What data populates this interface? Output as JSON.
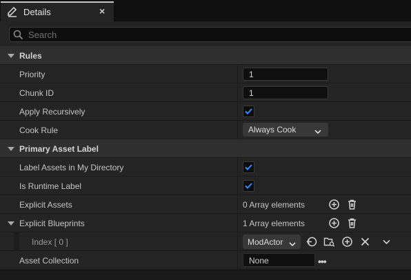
{
  "tab": {
    "title": "Details",
    "close": "×"
  },
  "search": {
    "placeholder": "Search",
    "value": ""
  },
  "rules": {
    "label": "Rules",
    "priority": {
      "label": "Priority",
      "value": "1"
    },
    "chunk_id": {
      "label": "Chunk ID",
      "value": "1"
    },
    "apply_recursively": {
      "label": "Apply Recursively",
      "checked": true
    },
    "cook_rule": {
      "label": "Cook Rule",
      "value": "Always Cook"
    }
  },
  "primary_asset_label": {
    "label": "Primary Asset Label",
    "label_assets": {
      "label": "Label Assets in My Directory",
      "checked": true
    },
    "is_runtime": {
      "label": "Is Runtime Label",
      "checked": true
    },
    "explicit_assets": {
      "label": "Explicit Assets",
      "value": "0 Array elements"
    },
    "explicit_blueprints": {
      "label": "Explicit Blueprints",
      "value": "1 Array elements"
    },
    "index0": {
      "label": "Index [ 0 ]",
      "value": "ModActor"
    },
    "asset_collection": {
      "label": "Asset Collection",
      "value": "None",
      "more": "•••"
    }
  },
  "colors": {
    "accent": "#2f8fff",
    "panel": "#242424",
    "category": "#2f2f2f"
  }
}
